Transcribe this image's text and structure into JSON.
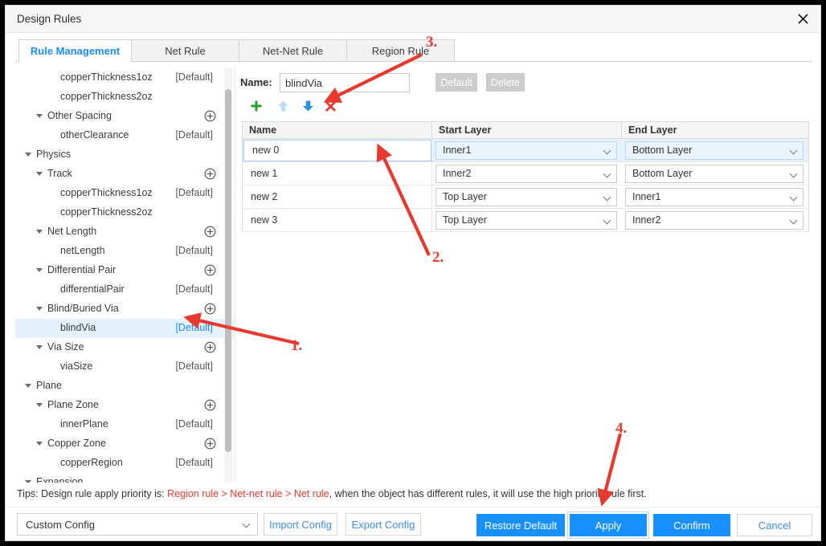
{
  "window": {
    "title": "Design Rules",
    "close_icon": "close-icon"
  },
  "tabs": [
    {
      "label": "Rule Management",
      "active": true
    },
    {
      "label": "Net Rule",
      "active": false
    },
    {
      "label": "Net-Net Rule",
      "active": false
    },
    {
      "label": "Region Rule",
      "active": false
    }
  ],
  "tree": {
    "items": [
      {
        "label": "copperThickness1oz",
        "indent": 3,
        "caret": false,
        "tag": "[Default]",
        "plus": false,
        "selected": false
      },
      {
        "label": "copperThickness2oz",
        "indent": 3,
        "caret": false,
        "tag": "",
        "plus": false,
        "selected": false
      },
      {
        "label": "Other Spacing",
        "indent": 2,
        "caret": true,
        "tag": "",
        "plus": true,
        "selected": false
      },
      {
        "label": "otherClearance",
        "indent": 3,
        "caret": false,
        "tag": "[Default]",
        "plus": false,
        "selected": false
      },
      {
        "label": "Physics",
        "indent": 1,
        "caret": true,
        "tag": "",
        "plus": false,
        "selected": false
      },
      {
        "label": "Track",
        "indent": 2,
        "caret": true,
        "tag": "",
        "plus": true,
        "selected": false
      },
      {
        "label": "copperThickness1oz",
        "indent": 3,
        "caret": false,
        "tag": "[Default]",
        "plus": false,
        "selected": false
      },
      {
        "label": "copperThickness2oz",
        "indent": 3,
        "caret": false,
        "tag": "",
        "plus": false,
        "selected": false
      },
      {
        "label": "Net Length",
        "indent": 2,
        "caret": true,
        "tag": "",
        "plus": true,
        "selected": false
      },
      {
        "label": "netLength",
        "indent": 3,
        "caret": false,
        "tag": "[Default]",
        "plus": false,
        "selected": false
      },
      {
        "label": "Differential Pair",
        "indent": 2,
        "caret": true,
        "tag": "",
        "plus": true,
        "selected": false
      },
      {
        "label": "differentialPair",
        "indent": 3,
        "caret": false,
        "tag": "[Default]",
        "plus": false,
        "selected": false
      },
      {
        "label": "Blind/Buried Via",
        "indent": 2,
        "caret": true,
        "tag": "",
        "plus": true,
        "selected": false
      },
      {
        "label": "blindVia",
        "indent": 3,
        "caret": false,
        "tag": "[Default]",
        "plus": false,
        "selected": true
      },
      {
        "label": "Via Size",
        "indent": 2,
        "caret": true,
        "tag": "",
        "plus": true,
        "selected": false
      },
      {
        "label": "viaSize",
        "indent": 3,
        "caret": false,
        "tag": "[Default]",
        "plus": false,
        "selected": false
      },
      {
        "label": "Plane",
        "indent": 1,
        "caret": true,
        "tag": "",
        "plus": false,
        "selected": false
      },
      {
        "label": "Plane Zone",
        "indent": 2,
        "caret": true,
        "tag": "",
        "plus": true,
        "selected": false
      },
      {
        "label": "innerPlane",
        "indent": 3,
        "caret": false,
        "tag": "[Default]",
        "plus": false,
        "selected": false
      },
      {
        "label": "Copper Zone",
        "indent": 2,
        "caret": true,
        "tag": "",
        "plus": true,
        "selected": false
      },
      {
        "label": "copperRegion",
        "indent": 3,
        "caret": false,
        "tag": "[Default]",
        "plus": false,
        "selected": false
      },
      {
        "label": "Expansion",
        "indent": 1,
        "caret": true,
        "tag": "",
        "plus": false,
        "selected": false
      }
    ]
  },
  "editor": {
    "name_label": "Name:",
    "name_value": "blindVia",
    "default_button": "Default",
    "delete_button": "Delete",
    "toolbar": {
      "add_icon": "plus-icon",
      "move_up_icon": "arrow-up-icon",
      "move_down_icon": "arrow-down-icon",
      "remove_icon": "red-x-icon"
    }
  },
  "table": {
    "columns": [
      "Name",
      "Start Layer",
      "End Layer"
    ],
    "rows": [
      {
        "name": "new 0",
        "start_layer": "Inner1",
        "end_layer": "Bottom Layer",
        "selected": true
      },
      {
        "name": "new 1",
        "start_layer": "Inner2",
        "end_layer": "Bottom Layer",
        "selected": false
      },
      {
        "name": "new 2",
        "start_layer": "Top Layer",
        "end_layer": "Inner1",
        "selected": false
      },
      {
        "name": "new 3",
        "start_layer": "Top Layer",
        "end_layer": "Inner2",
        "selected": false
      }
    ]
  },
  "tips": {
    "prefix": "Tips: Design rule apply priority is: ",
    "r1": "Region rule",
    "sep1": " > ",
    "r2": "Net-net rule",
    "sep2": " > ",
    "r3": "Net rule",
    "suffix": ", when the object has different rules, it will use the high priority rule first."
  },
  "footer": {
    "config_value": "Custom Config",
    "import_label": "Import Config",
    "export_label": "Export Config",
    "restore_label": "Restore Default",
    "apply_label": "Apply",
    "confirm_label": "Confirm",
    "cancel_label": "Cancel"
  },
  "annotations": {
    "n1": "1.",
    "n2": "2.",
    "n3": "3.",
    "n4": "4."
  },
  "colors": {
    "accent_blue": "#1890ff",
    "tab_active": "#1a8cff",
    "annotation_red": "#e8392e",
    "selection_blue": "#e3f2fd"
  }
}
